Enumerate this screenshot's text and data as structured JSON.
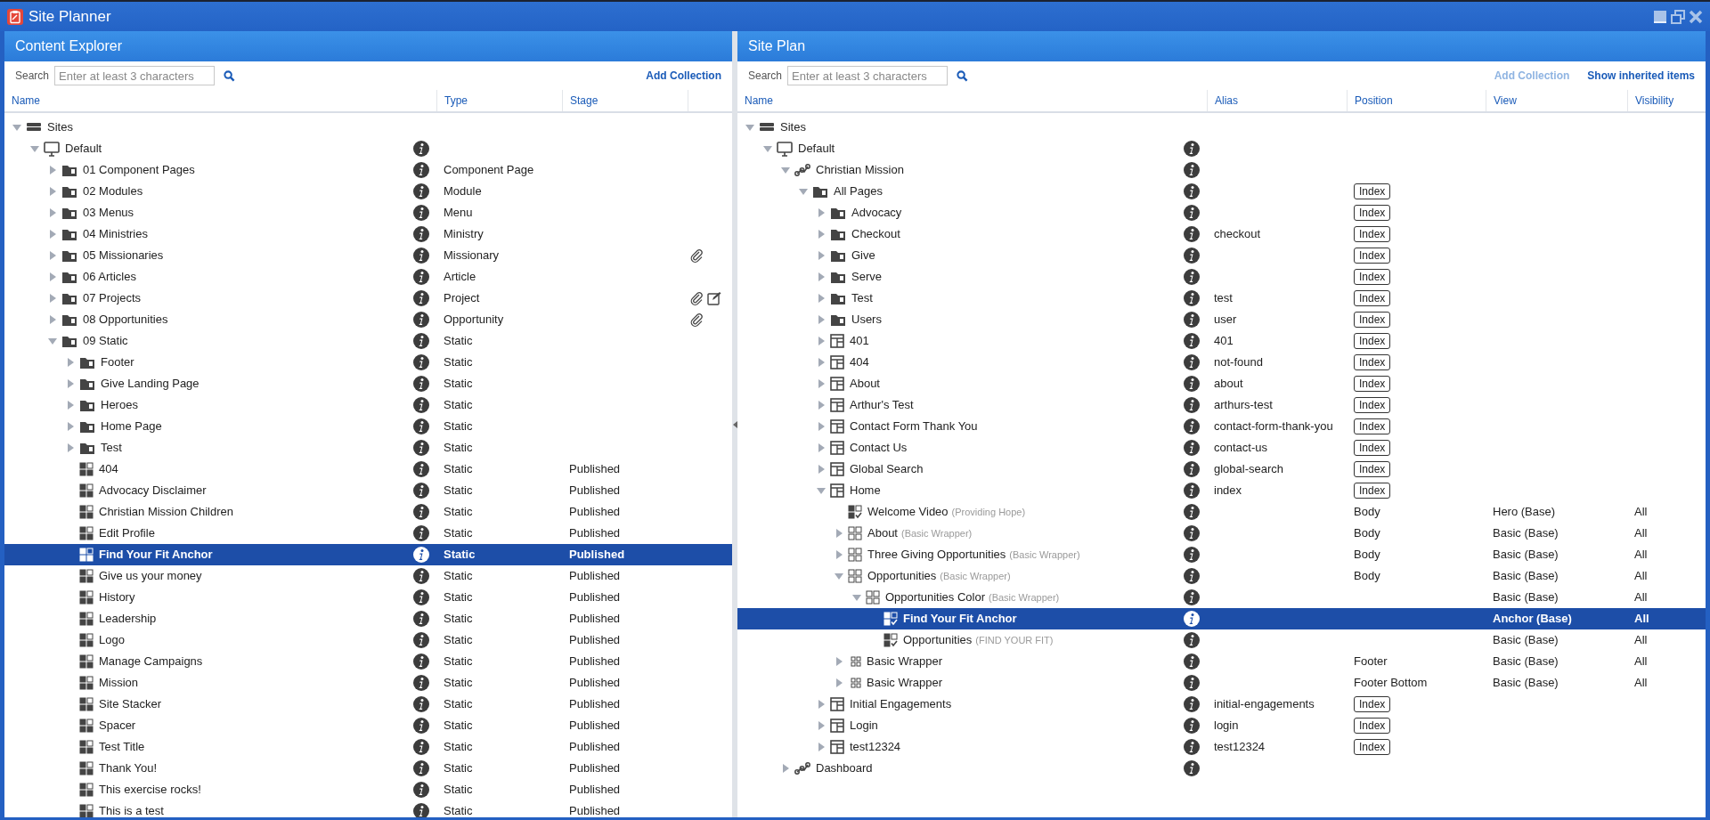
{
  "window": {
    "title": "Site Planner"
  },
  "left_panel": {
    "title": "Content Explorer",
    "search": {
      "label": "Search",
      "placeholder": "Enter at least 3 characters"
    },
    "actions": [
      {
        "label": "Add Collection",
        "disabled": false
      }
    ],
    "columns": [
      "Name",
      "Type",
      "Stage"
    ],
    "tree": [
      {
        "label": "Sites",
        "kind": "sites",
        "expanded": true,
        "selected": false,
        "children": [
          {
            "label": "Default",
            "kind": "site",
            "expanded": true,
            "selected": false,
            "children": [
              {
                "label": "01 Component Pages",
                "kind": "folder",
                "expanded": false,
                "selected": false,
                "type": "Component Page"
              },
              {
                "label": "02 Modules",
                "kind": "folder",
                "expanded": false,
                "selected": false,
                "type": "Module"
              },
              {
                "label": "03 Menus",
                "kind": "folder",
                "expanded": false,
                "selected": false,
                "type": "Menu"
              },
              {
                "label": "04 Ministries",
                "kind": "folder",
                "expanded": false,
                "selected": false,
                "type": "Ministry"
              },
              {
                "label": "05 Missionaries",
                "kind": "folder",
                "expanded": false,
                "selected": false,
                "type": "Missionary",
                "attachment": true
              },
              {
                "label": "06 Articles",
                "kind": "folder",
                "expanded": false,
                "selected": false,
                "type": "Article"
              },
              {
                "label": "07 Projects",
                "kind": "folder",
                "expanded": false,
                "selected": false,
                "type": "Project",
                "attachment": true,
                "edit": true
              },
              {
                "label": "08 Opportunities",
                "kind": "folder",
                "expanded": false,
                "selected": false,
                "type": "Opportunity",
                "attachment": true
              },
              {
                "label": "09 Static",
                "kind": "folder",
                "expanded": true,
                "selected": false,
                "type": "Static",
                "children": [
                  {
                    "label": "Footer",
                    "kind": "folder",
                    "expanded": false,
                    "selected": false,
                    "type": "Static"
                  },
                  {
                    "label": "Give Landing Page",
                    "kind": "folder",
                    "expanded": false,
                    "selected": false,
                    "type": "Static"
                  },
                  {
                    "label": "Heroes",
                    "kind": "folder",
                    "expanded": false,
                    "selected": false,
                    "type": "Static"
                  },
                  {
                    "label": "Home Page",
                    "kind": "folder",
                    "expanded": false,
                    "selected": false,
                    "type": "Static"
                  },
                  {
                    "label": "Test",
                    "kind": "folder",
                    "expanded": false,
                    "selected": false,
                    "type": "Static"
                  },
                  {
                    "label": "404",
                    "kind": "content",
                    "selected": false,
                    "type": "Static",
                    "stage": "Published"
                  },
                  {
                    "label": "Advocacy Disclaimer",
                    "kind": "content",
                    "selected": false,
                    "type": "Static",
                    "stage": "Published"
                  },
                  {
                    "label": "Christian Mission Children",
                    "kind": "content",
                    "selected": false,
                    "type": "Static",
                    "stage": "Published"
                  },
                  {
                    "label": "Edit Profile",
                    "kind": "content",
                    "selected": false,
                    "type": "Static",
                    "stage": "Published"
                  },
                  {
                    "label": "Find Your Fit Anchor",
                    "kind": "content",
                    "selected": true,
                    "type": "Static",
                    "stage": "Published"
                  },
                  {
                    "label": "Give us your money",
                    "kind": "content",
                    "selected": false,
                    "type": "Static",
                    "stage": "Published"
                  },
                  {
                    "label": "History",
                    "kind": "content",
                    "selected": false,
                    "type": "Static",
                    "stage": "Published"
                  },
                  {
                    "label": "Leadership",
                    "kind": "content",
                    "selected": false,
                    "type": "Static",
                    "stage": "Published"
                  },
                  {
                    "label": "Logo",
                    "kind": "content",
                    "selected": false,
                    "type": "Static",
                    "stage": "Published"
                  },
                  {
                    "label": "Manage Campaigns",
                    "kind": "content",
                    "selected": false,
                    "type": "Static",
                    "stage": "Published"
                  },
                  {
                    "label": "Mission",
                    "kind": "content",
                    "selected": false,
                    "type": "Static",
                    "stage": "Published"
                  },
                  {
                    "label": "Site Stacker",
                    "kind": "content",
                    "selected": false,
                    "type": "Static",
                    "stage": "Published"
                  },
                  {
                    "label": "Spacer",
                    "kind": "content",
                    "selected": false,
                    "type": "Static",
                    "stage": "Published"
                  },
                  {
                    "label": "Test Title",
                    "kind": "content",
                    "selected": false,
                    "type": "Static",
                    "stage": "Published"
                  },
                  {
                    "label": "Thank You!",
                    "kind": "content",
                    "selected": false,
                    "type": "Static",
                    "stage": "Published"
                  },
                  {
                    "label": "This exercise rocks!",
                    "kind": "content",
                    "selected": false,
                    "type": "Static",
                    "stage": "Published"
                  },
                  {
                    "label": "This is a test",
                    "kind": "content",
                    "selected": false,
                    "type": "Static",
                    "stage": "Published"
                  }
                ]
              }
            ]
          }
        ]
      }
    ]
  },
  "right_panel": {
    "title": "Site Plan",
    "search": {
      "label": "Search",
      "placeholder": "Enter at least 3 characters"
    },
    "actions": [
      {
        "label": "Add Collection",
        "disabled": true
      },
      {
        "label": "Show inherited items",
        "disabled": false
      }
    ],
    "columns": [
      "Name",
      "Alias",
      "Position",
      "View",
      "Visibility"
    ],
    "tree": [
      {
        "label": "Sites",
        "kind": "sites",
        "expanded": true,
        "selected": false,
        "children": [
          {
            "label": "Default",
            "kind": "site",
            "expanded": true,
            "selected": false,
            "children": [
              {
                "label": "Christian Mission",
                "kind": "mission",
                "expanded": true,
                "selected": false,
                "children": [
                  {
                    "label": "All Pages",
                    "kind": "folder",
                    "expanded": true,
                    "selected": false,
                    "position_button": "Index",
                    "children": [
                      {
                        "label": "Advocacy",
                        "kind": "folder",
                        "expanded": false,
                        "selected": false,
                        "position_button": "Index"
                      },
                      {
                        "label": "Checkout",
                        "kind": "folder",
                        "expanded": false,
                        "selected": false,
                        "alias": "checkout",
                        "position_button": "Index"
                      },
                      {
                        "label": "Give",
                        "kind": "folder",
                        "expanded": false,
                        "selected": false,
                        "position_button": "Index"
                      },
                      {
                        "label": "Serve",
                        "kind": "folder",
                        "expanded": false,
                        "selected": false,
                        "position_button": "Index"
                      },
                      {
                        "label": "Test",
                        "kind": "folder",
                        "expanded": false,
                        "selected": false,
                        "alias": "test",
                        "position_button": "Index"
                      },
                      {
                        "label": "Users",
                        "kind": "folder",
                        "expanded": false,
                        "selected": false,
                        "alias": "user",
                        "position_button": "Index"
                      },
                      {
                        "label": "401",
                        "kind": "page",
                        "expanded": false,
                        "selected": false,
                        "alias": "401",
                        "position_button": "Index"
                      },
                      {
                        "label": "404",
                        "kind": "page",
                        "expanded": false,
                        "selected": false,
                        "alias": "not-found",
                        "position_button": "Index"
                      },
                      {
                        "label": "About",
                        "kind": "page",
                        "expanded": false,
                        "selected": false,
                        "alias": "about",
                        "position_button": "Index"
                      },
                      {
                        "label": "Arthur's Test",
                        "kind": "page",
                        "expanded": false,
                        "selected": false,
                        "alias": "arthurs-test",
                        "position_button": "Index"
                      },
                      {
                        "label": "Contact Form Thank You",
                        "kind": "page",
                        "expanded": false,
                        "selected": false,
                        "alias": "contact-form-thank-you",
                        "position_button": "Index"
                      },
                      {
                        "label": "Contact Us",
                        "kind": "page",
                        "expanded": false,
                        "selected": false,
                        "alias": "contact-us",
                        "position_button": "Index"
                      },
                      {
                        "label": "Global Search",
                        "kind": "page",
                        "expanded": false,
                        "selected": false,
                        "alias": "global-search",
                        "position_button": "Index"
                      },
                      {
                        "label": "Home",
                        "kind": "page",
                        "expanded": true,
                        "selected": false,
                        "alias": "index",
                        "position_button": "Index",
                        "children": [
                          {
                            "label": "Welcome Video",
                            "note": "(Providing Hope)",
                            "kind": "module",
                            "selected": false,
                            "position": "Body",
                            "view": "Hero (Base)",
                            "visibility": "All"
                          },
                          {
                            "label": "About",
                            "note": "(Basic Wrapper)",
                            "kind": "wrapper",
                            "expanded": false,
                            "selected": false,
                            "position": "Body",
                            "view": "Basic (Base)",
                            "visibility": "All"
                          },
                          {
                            "label": "Three Giving Opportunities",
                            "note": "(Basic Wrapper)",
                            "kind": "wrapper",
                            "expanded": false,
                            "selected": false,
                            "position": "Body",
                            "view": "Basic (Base)",
                            "visibility": "All"
                          },
                          {
                            "label": "Opportunities",
                            "note": "(Basic Wrapper)",
                            "kind": "wrapper",
                            "expanded": true,
                            "selected": false,
                            "position": "Body",
                            "view": "Basic (Base)",
                            "visibility": "All",
                            "children": [
                              {
                                "label": "Opportunities Color",
                                "note": "(Basic Wrapper)",
                                "kind": "wrapper",
                                "expanded": true,
                                "selected": false,
                                "view": "Basic (Base)",
                                "visibility": "All",
                                "children": [
                                  {
                                    "label": "Find Your Fit Anchor",
                                    "kind": "module",
                                    "selected": true,
                                    "view": "Anchor (Base)",
                                    "visibility": "All"
                                  },
                                  {
                                    "label": "Opportunities",
                                    "note": "(FIND YOUR FIT)",
                                    "kind": "module",
                                    "selected": false,
                                    "view": "Basic (Base)",
                                    "visibility": "All"
                                  }
                                ]
                              }
                            ]
                          },
                          {
                            "label": "Basic Wrapper",
                            "kind": "wrapper-small",
                            "expanded": false,
                            "selected": false,
                            "position": "Footer",
                            "view": "Basic (Base)",
                            "visibility": "All"
                          },
                          {
                            "label": "Basic Wrapper",
                            "kind": "wrapper-small",
                            "expanded": false,
                            "selected": false,
                            "position": "Footer Bottom",
                            "view": "Basic (Base)",
                            "visibility": "All"
                          }
                        ]
                      },
                      {
                        "label": "Initial Engagements",
                        "kind": "page",
                        "expanded": false,
                        "selected": false,
                        "alias": "initial-engagements",
                        "position_button": "Index"
                      },
                      {
                        "label": "Login",
                        "kind": "page",
                        "expanded": false,
                        "selected": false,
                        "alias": "login",
                        "position_button": "Index"
                      },
                      {
                        "label": "test12324",
                        "kind": "page",
                        "expanded": false,
                        "selected": false,
                        "alias": "test12324",
                        "position_button": "Index"
                      }
                    ]
                  }
                ]
              },
              {
                "label": "Dashboard",
                "kind": "mission",
                "expanded": false,
                "selected": false
              }
            ]
          }
        ]
      }
    ]
  }
}
